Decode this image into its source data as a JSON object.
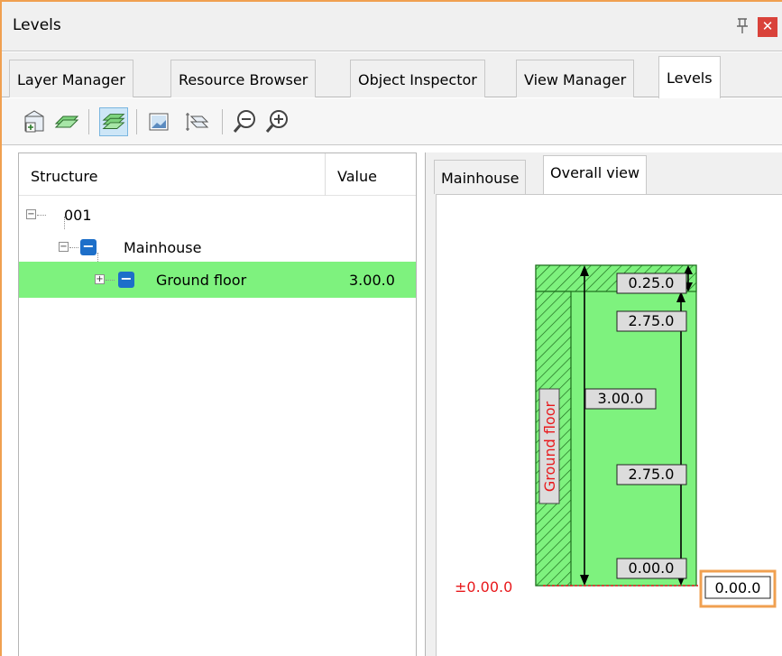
{
  "window": {
    "title": "Levels"
  },
  "tabs": [
    {
      "label": "Layer Manager"
    },
    {
      "label": "Resource Browser"
    },
    {
      "label": "Object Inspector"
    },
    {
      "label": "View Manager"
    },
    {
      "label": "Levels"
    }
  ],
  "toolbar": {
    "buttons": [
      "new-level-icon",
      "layers-icon",
      "layers-active-icon",
      "image-icon",
      "level-3d-icon",
      "zoom-out-icon",
      "zoom-in-icon"
    ]
  },
  "tree": {
    "col_structure": "Structure",
    "col_value": "Value",
    "rows": [
      {
        "label": "001",
        "value": ""
      },
      {
        "label": "Mainhouse",
        "value": ""
      },
      {
        "label": "Ground floor",
        "value": "3.00.0"
      }
    ]
  },
  "view": {
    "tabs": [
      {
        "label": "Mainhouse"
      },
      {
        "label": "Overall view"
      }
    ],
    "floor_name": "Ground floor",
    "labels": {
      "top": "0.25.0",
      "upper_right": "2.75.0",
      "total": "3.00.0",
      "mid_right": "2.75.0",
      "bottom_right": "0.00.0",
      "zero_left": "±0.00.0",
      "zero_box": "0.00.0"
    }
  },
  "colors": {
    "selected_row": "#7ef27e",
    "floor_fill": "#7ef27e",
    "accent_orange": "#f0a050",
    "zero_line": "#e8191c"
  }
}
